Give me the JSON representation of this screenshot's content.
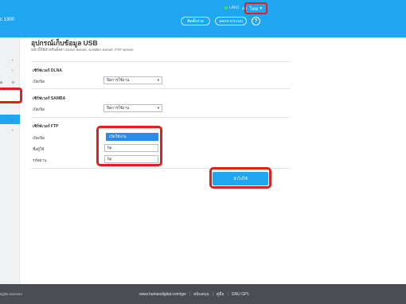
{
  "header": {
    "brand": "c 1300",
    "lan_status": "LAN1",
    "language_small": "ภา",
    "language_button": "ไทย",
    "button_1": "ติดตั้งง่าย",
    "button_2": "ออกจากระบบ",
    "help": "?",
    "colors": {
      "bar": "#1ea6ef",
      "highlight": "#e0201a"
    }
  },
  "sidebar": {
    "marks": [
      "‹",
      "‹",
      "o",
      "‹",
      "‹"
    ],
    "fragment": "a"
  },
  "page": {
    "title": "อุปกรณ์เก็บข้อมูล USB",
    "description": "หน้านี้ใช้สำหรับตั้งค่า DLNA Server, SAMBA Server, FTP Server."
  },
  "sections": {
    "dlna": {
      "title": "เซิร์ฟเวอร์ DLNA",
      "enable_label": "เปิด/ปิด",
      "enable_value": "ปิดการใช้งาน"
    },
    "samba": {
      "title": "เซิร์ฟเวอร์ SAMBA",
      "enable_label": "เปิด/ปิด",
      "enable_value": "ปิดการใช้งาน"
    },
    "ftp": {
      "title": "เซิร์ฟเวอร์ FTP",
      "enable_label": "เปิด/ปิด",
      "enable_value": "เปิดใช้งาน",
      "username_label": "ชื่อผู้ใช้",
      "username_value": "ftp",
      "password_label": "รหัสผ่าน",
      "password_value": "ftp"
    }
  },
  "apply_button": "นำไปใช้",
  "footer": {
    "left": "rights reserved",
    "links": [
      "www.humaxdigital.com/gw",
      "สนับสนุน",
      "คู่มือ",
      "GNU GPL"
    ]
  }
}
